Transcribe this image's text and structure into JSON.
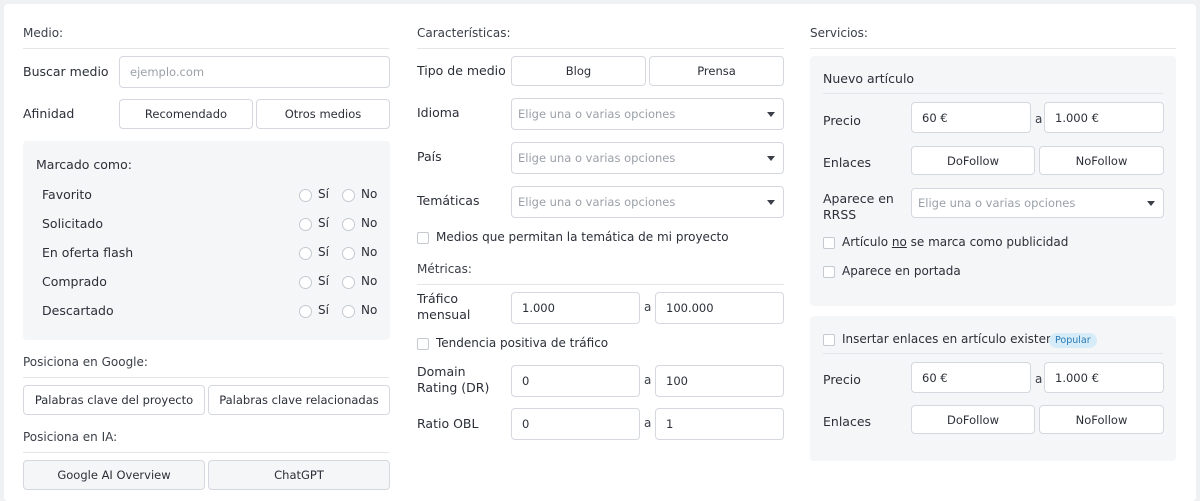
{
  "col1": {
    "medio_title": "Medio:",
    "buscar_label": "Buscar medio",
    "buscar_placeholder": "ejemplo.com",
    "afinidad_label": "Afinidad",
    "afinidad_options": [
      "Recomendado",
      "Otros medios"
    ],
    "marcado_title": "Marcado como:",
    "marcado_rows": [
      {
        "label": "Favorito",
        "yes": "Sí",
        "no": "No"
      },
      {
        "label": "Solicitado",
        "yes": "Sí",
        "no": "No"
      },
      {
        "label": "En oferta flash",
        "yes": "Sí",
        "no": "No"
      },
      {
        "label": "Comprado",
        "yes": "Sí",
        "no": "No"
      },
      {
        "label": "Descartado",
        "yes": "Sí",
        "no": "No"
      }
    ],
    "google_title": "Posiciona en Google:",
    "google_options": [
      "Palabras clave del proyecto",
      "Palabras clave relacionadas"
    ],
    "ia_title": "Posiciona en IA:",
    "ia_options": [
      "Google AI Overview",
      "ChatGPT"
    ]
  },
  "col2": {
    "caracteristicas_title": "Características:",
    "tipo_label": "Tipo de medio",
    "tipo_options": [
      "Blog",
      "Prensa"
    ],
    "idioma_label": "Idioma",
    "pais_label": "País",
    "tematicas_label": "Temáticas",
    "select_placeholder": "Elige una o varias opciones",
    "tematica_check": "Medios que permitan la temática de mi proyecto",
    "metricas_title": "Métricas:",
    "trafico_label_1": "Tráfico",
    "trafico_label_2": "mensual",
    "trafico_min": "1.000",
    "trafico_max": "100.000",
    "tendencia_check": "Tendencia positiva de tráfico",
    "dr_label_1": "Domain",
    "dr_label_2": "Rating (DR)",
    "dr_min": "0",
    "dr_max": "100",
    "obl_label": "Ratio OBL",
    "obl_min": "0",
    "obl_max": "1",
    "range_sep": "a"
  },
  "col3": {
    "servicios_title": "Servicios:",
    "nuevo_title": "Nuevo artículo",
    "precio_label": "Precio",
    "precio_min": "60 €",
    "precio_max": "1.000 €",
    "enlaces_label": "Enlaces",
    "enlaces_options": [
      "DoFollow",
      "NoFollow"
    ],
    "rrss_label_1": "Aparece en",
    "rrss_label_2": "RRSS",
    "rrss_placeholder": "Elige una o varias opciones",
    "publicidad_pre": "Artículo ",
    "publicidad_no": "no",
    "publicidad_post": " se marca como publicidad",
    "portada_check": "Aparece en portada",
    "insertar_check": "Insertar enlaces en artículo existente",
    "popular_badge": "Popular",
    "precio2_label": "Precio",
    "precio2_min": "60 €",
    "precio2_max": "1.000 €",
    "enlaces2_label": "Enlaces",
    "enlaces2_options": [
      "DoFollow",
      "NoFollow"
    ],
    "range_sep": "a"
  }
}
